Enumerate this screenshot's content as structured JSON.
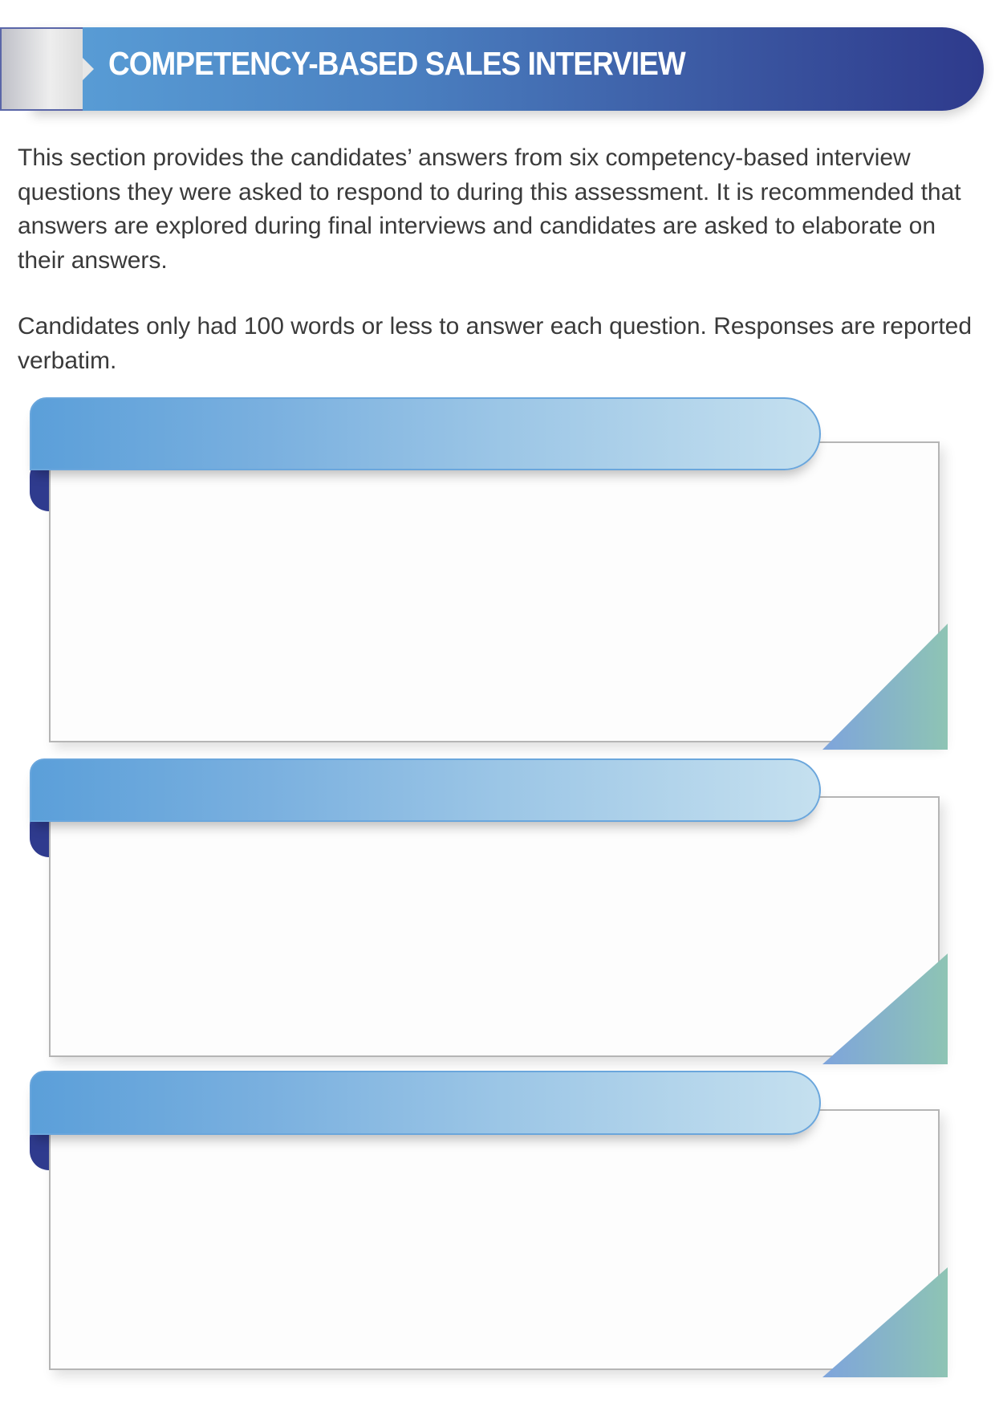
{
  "header": {
    "title": "COMPETENCY-BASED SALES INTERVIEW"
  },
  "intro": {
    "paragraph1": "This section provides the candidates’ answers from six competency-based interview questions they were asked to respond to during this assessment. It is recommended that answers are explored during final interviews and candidates are asked to elaborate on their answers.",
    "paragraph2": "Candidates only had 100 words or less to answer each question. Responses are reported verbatim."
  },
  "colors": {
    "header_dark": "#2e3a8c",
    "header_light": "#5aa0d8",
    "ribbon_light": "#c5e0ef",
    "corner_teal": "#8ec4b4"
  }
}
